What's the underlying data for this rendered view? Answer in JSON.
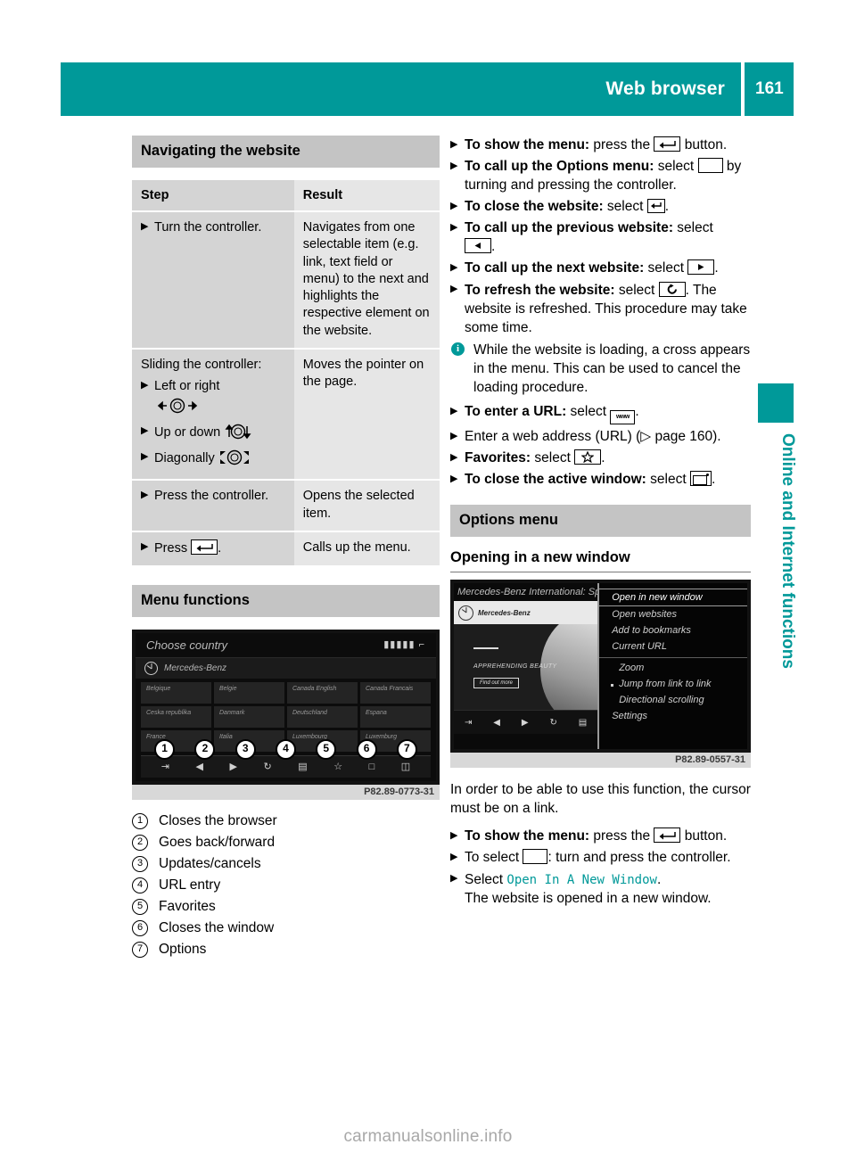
{
  "header": {
    "title": "Web browser",
    "page_number": "161"
  },
  "side_tab": {
    "label": "Online and Internet functions"
  },
  "left_column": {
    "section_heading": "Navigating the website",
    "table": {
      "columns": [
        "Step",
        "Result"
      ],
      "rows": [
        {
          "step": "Turn the controller.",
          "result": "Navigates from one selectable item (e.g. link, text field or menu) to the next and highlights the respective element on the website."
        },
        {
          "step": "Sliding the controller:",
          "sub_steps": [
            "Left or right",
            "Up or down",
            "Diagonally"
          ],
          "result": "Moves the pointer on the page."
        },
        {
          "step": "Press the controller.",
          "result": "Opens the selected item."
        },
        {
          "step_prefix": "Press",
          "step_suffix": ".",
          "step_icon": "return-key-icon",
          "result": "Calls up the menu."
        }
      ]
    },
    "menu_functions_heading": "Menu functions",
    "figure1": {
      "caption": "P82.89-0773-31",
      "screen_title": "Choose country",
      "brand_label": "Mercedes-Benz",
      "country_cells": [
        "Belgique",
        "Belgie",
        "Canada English",
        "Canada Francais",
        "Ceska republika",
        "Danmark",
        "Deutschland",
        "Espana",
        "France",
        "Italia",
        "Luxembourg",
        "Luxemburg"
      ],
      "callouts": [
        "1",
        "2",
        "3",
        "4",
        "5",
        "6",
        "7"
      ]
    },
    "legend": [
      {
        "num": "1",
        "text": "Closes the browser"
      },
      {
        "num": "2",
        "text": "Goes back/forward"
      },
      {
        "num": "3",
        "text": "Updates/cancels"
      },
      {
        "num": "4",
        "text": "URL entry"
      },
      {
        "num": "5",
        "text": "Favorites"
      },
      {
        "num": "6",
        "text": "Closes the window"
      },
      {
        "num": "7",
        "text": "Options"
      }
    ]
  },
  "right_column": {
    "instructions": [
      {
        "bold": "To show the menu:",
        "text_before_icon": " press the ",
        "icon": "return-key-icon",
        "text_after_icon": " button."
      },
      {
        "bold": "To call up the Options menu:",
        "text_before_icon": " select ",
        "icon": "menu-bars-icon",
        "text_after_icon": " by turning and pressing the controller."
      },
      {
        "bold": "To close the website:",
        "text_before_icon": " select ",
        "icon": "back-arrow-icon",
        "text_after_icon": "."
      },
      {
        "bold": "To call up the previous website:",
        "text_before_icon": " select ",
        "icon": "left-arrow-icon",
        "text_after_icon": "."
      },
      {
        "bold": "To call up the next website:",
        "text_before_icon": " select ",
        "icon": "right-arrow-icon",
        "text_after_icon": "."
      },
      {
        "bold": "To refresh the website:",
        "text_before_icon": " select ",
        "icon": "refresh-icon",
        "text_after_icon": ". The website is refreshed. This procedure may take some time."
      }
    ],
    "note": "While the website is loading, a cross appears in the menu. This can be used to cancel the loading procedure.",
    "instructions2": [
      {
        "bold": "To enter a URL:",
        "text_before_icon": " select ",
        "icon": "www-icon",
        "text_after_icon": "."
      },
      {
        "bold": "",
        "plain": "Enter a web address (URL) (▷ page 160)."
      },
      {
        "bold": "Favorites:",
        "text_before_icon": " select ",
        "icon": "star-icon",
        "text_after_icon": "."
      },
      {
        "bold": "To close the active window:",
        "text_before_icon": " select ",
        "icon": "close-window-icon",
        "text_after_icon": "."
      }
    ],
    "options_menu_heading": "Options menu",
    "opening_heading": "Opening in a new window",
    "figure2": {
      "caption": "P82.89-0557-31",
      "screen_title": "Mercedes-Benz International: Sports",
      "brand_label": "Mercedes-Benz",
      "hero_text": "APPREHENDING BEAUTY",
      "hero_button": "Find out more",
      "menu_items": [
        {
          "label": "Open in new window",
          "selected": true
        },
        {
          "label": "Open websites",
          "selected": false
        },
        {
          "label": "Add to bookmarks",
          "selected": false
        },
        {
          "label": "Current URL",
          "selected": false
        },
        {
          "label": "Zoom",
          "selected": false,
          "indent": true,
          "divider": true
        },
        {
          "label": "Jump from link to link",
          "selected": false,
          "bulleted": true
        },
        {
          "label": "Directional scrolling",
          "selected": false,
          "indent": true
        },
        {
          "label": "Settings",
          "selected": false
        }
      ]
    },
    "body_text": "In order to be able to use this function, the cursor must be on a link.",
    "instructions3": [
      {
        "bold": "To show the menu:",
        "text_before_icon": " press the ",
        "icon": "return-key-icon",
        "text_after_icon": " button."
      },
      {
        "bold": "",
        "text_before_icon": "To select ",
        "icon": "menu-bars-icon",
        "text_after_icon": ": turn and press the controller."
      }
    ],
    "select_line": {
      "prefix": "Select ",
      "command": "Open In A New Window",
      "suffix": ".",
      "result": "The website is opened in a new window."
    }
  },
  "watermark": "carmanualsonline.info"
}
